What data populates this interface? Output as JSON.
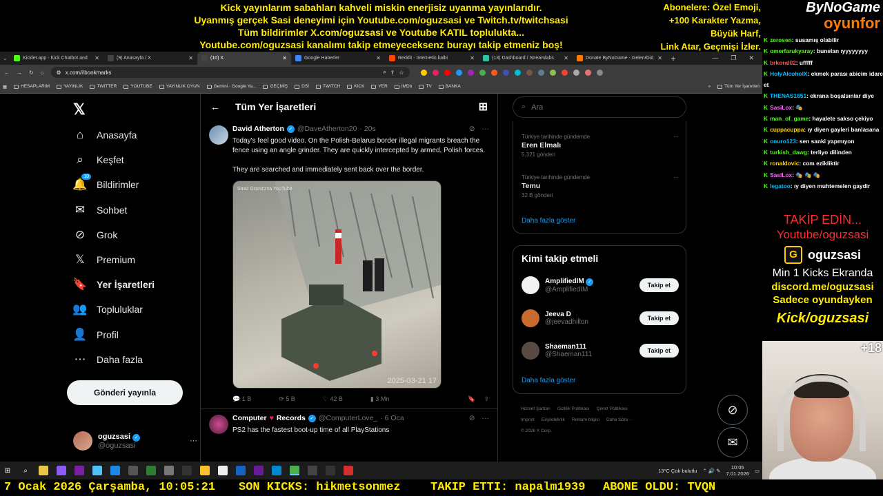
{
  "stream": {
    "top_lines": [
      "Kick yayınlarım sabahları kahveli miskin enerjisiz uyanma yayınlarıdır.",
      "Uyanmış gerçek Sasi deneyimi için Youtube.com/oguzsasi ve Twitch.tv/twitchsasi",
      "Tüm bildirimler X.com/oguzsasi ve Youtube KATIL toplulukta...",
      "Youtube.com/oguzsasi kanalımı takip etmeyeceksenz burayı takip etmeniz boş!"
    ],
    "right_lines": [
      "Abonelere: Özel Emoji,",
      "+100 Karakter Yazma,",
      "Büyük Harf,",
      "Link Atar, Geçmişi İzler."
    ],
    "logo_top": "ByNoGame",
    "logo_bottom": "oyunfor",
    "ticker": {
      "date": "7 Ocak 2026 Çarşamba, 10:05:21",
      "kicks": "SON KICKS: hikmetsonmez",
      "follow": "TAKIP ETTI: napalm1939",
      "sub": "ABONE OLDU: TVQN"
    },
    "chat": [
      {
        "user": "zerosen",
        "msg": ": susamış olabilir",
        "c": ""
      },
      {
        "user": "omerfarukyaray",
        "msg": ": bunelan ıyyyyyyyy",
        "c": ""
      },
      {
        "user": "brkoral02",
        "msg": ": ufffff",
        "c": "c3"
      },
      {
        "user": "HolyAlcoholX",
        "msg": ": ekmek parası abicim idare et",
        "c": "c4"
      },
      {
        "user": "THENAS1651",
        "msg": ": ekrana boşalsınlar diye",
        "c": "c4"
      },
      {
        "user": "SasiLox",
        "msg": ": 🎭",
        "c": "c2"
      },
      {
        "user": "man_of_game",
        "msg": ": hayalete sakso çekiyo",
        "c": ""
      },
      {
        "user": "cuppacuppa",
        "msg": ": ıy diyen gayleri banlasana",
        "c": "c5"
      },
      {
        "user": "onuro123",
        "msg": ": sen sanki yapmıyon",
        "c": "c4"
      },
      {
        "user": "turkish_dawg",
        "msg": ": terliyo dilinden",
        "c": ""
      },
      {
        "user": "ronaldovic",
        "msg": ": com ezikliktir",
        "c": "c5"
      },
      {
        "user": "SasiLox",
        "msg": ": 🎭 🎭 🎭",
        "c": "c2"
      },
      {
        "user": "legatoo",
        "msg": ": ıy diyen muhtemelen gaydir",
        "c": "c4"
      }
    ],
    "promo": {
      "follow": "TAKİP EDİN...",
      "youtube": "Youtube/oguzsasi",
      "kick_name": "oguzsasi",
      "min_kicks": "Min 1 Kicks Ekranda",
      "discord": "discord.me/oguzsasi",
      "only_game": "Sadece oyundayken",
      "kick_url": "Kick/oguzsasi"
    },
    "age_badge": "+18"
  },
  "browser": {
    "tabs": [
      {
        "label": "Kicklet.app - Kick Chatbot and",
        "color": "#53fc18"
      },
      {
        "label": "(9) Anasayfa / X",
        "color": "#444"
      },
      {
        "label": "(10) X",
        "color": "#444"
      },
      {
        "label": "Google Haberler",
        "color": "#4285f4"
      },
      {
        "label": "Reddit - İnternetin kalbi",
        "color": "#ff4500"
      },
      {
        "label": "(13) Dashboard / Streamlabs",
        "color": "#31c3a2"
      },
      {
        "label": "Donate ByNoGame - Gelen/Gid",
        "color": "#ff7a00"
      }
    ],
    "url": "x.com/i/bookmarks",
    "bookmarks": [
      "HESAPLARIM",
      "YAYINLIK",
      "TWITTER",
      "YOUTUBE",
      "YAYINLIK OYUN",
      "Gemini - Google Ya...",
      "GEÇMİŞ",
      "DSİ",
      "TWITCH",
      "KICK",
      "YER",
      "IMDb",
      "TV",
      "BANKA"
    ],
    "bookmarks_end": "Tüm Yer İşaretleri"
  },
  "x": {
    "nav": [
      {
        "label": "Anasayfa",
        "icon": "⌂",
        "name": "home-icon"
      },
      {
        "label": "Keşfet",
        "icon": "⌕",
        "name": "explore-icon"
      },
      {
        "label": "Bildirimler",
        "icon": "🔔",
        "name": "bell-icon",
        "badge": "10"
      },
      {
        "label": "Sohbet",
        "icon": "✉",
        "name": "mail-icon"
      },
      {
        "label": "Grok",
        "icon": "⊘",
        "name": "grok-icon"
      },
      {
        "label": "Premium",
        "icon": "𝕏",
        "name": "premium-icon"
      },
      {
        "label": "Yer İşaretleri",
        "icon": "🔖",
        "name": "bookmark-icon",
        "active": true
      },
      {
        "label": "Topluluklar",
        "icon": "👥",
        "name": "communities-icon"
      },
      {
        "label": "Profil",
        "icon": "👤",
        "name": "profile-icon"
      },
      {
        "label": "Daha fazla",
        "icon": "⋯",
        "name": "more-icon"
      }
    ],
    "post_button": "Gönderi yayınla",
    "account": {
      "name": "oguzsasi",
      "handle": "@oguzsasi"
    },
    "header": "Tüm Yer İşaretleri",
    "tweets": [
      {
        "name": "David Atherton",
        "handle": "@DaveAtherton20",
        "time": "· 20s",
        "text": "Today's feel good video. On the Polish-Belarus border illegal migrants breach the fence using an angle grinder. They are quickly intercepted by armed, Polish forces.\n\nThey are searched and immediately sent back over the border.",
        "media_source": "Straż Graniczna YouTube",
        "media_timestamp": "2025-03-21 17",
        "replies": "1 B",
        "reposts": "5 B",
        "likes": "42 B",
        "views": "3 Mn"
      },
      {
        "name": "Computer",
        "name_tail": "Records",
        "handle": "@ComputerLove_",
        "time": "· 6 Oca",
        "text": "PS2 has the fastest boot-up time of all PlayStations"
      }
    ],
    "search_placeholder": "Ara",
    "trends": [
      {
        "context": "Türkiye tarihinde gündemde",
        "title": "Eren Elmalı",
        "count": "5.321 gönderi"
      },
      {
        "context": "Türkiye tarihinde gündemde",
        "title": "Temu",
        "count": "32 B gönderi"
      }
    ],
    "show_more": "Daha fazla göster",
    "who_title": "Kimi takip etmeli",
    "who": [
      {
        "name": "AmplifiedIM",
        "handle": "@AmplifiedIM",
        "btn": "Takip et",
        "color": "#f2f2f2",
        "verified": true
      },
      {
        "name": "Jeeva D",
        "handle": "@jeevadhillon",
        "btn": "Takip et",
        "color": "#c96b2e",
        "verified": false
      },
      {
        "name": "Shaeman111",
        "handle": "@Shaeman111",
        "btn": "Takip et",
        "color": "#5a4a44",
        "verified": false
      }
    ],
    "footer": [
      "Hizmet Şartları",
      "Gizlilik Politikası",
      "Çerez Politikası",
      "Imprint",
      "Erişilebilirlik",
      "Reklam bilgisi",
      "Daha fazla ···",
      "© 2026 X Corp."
    ]
  },
  "taskbar": {
    "weather": "13°C  Çok bulutlu",
    "time": "10:05",
    "date": "7.01.2026"
  }
}
